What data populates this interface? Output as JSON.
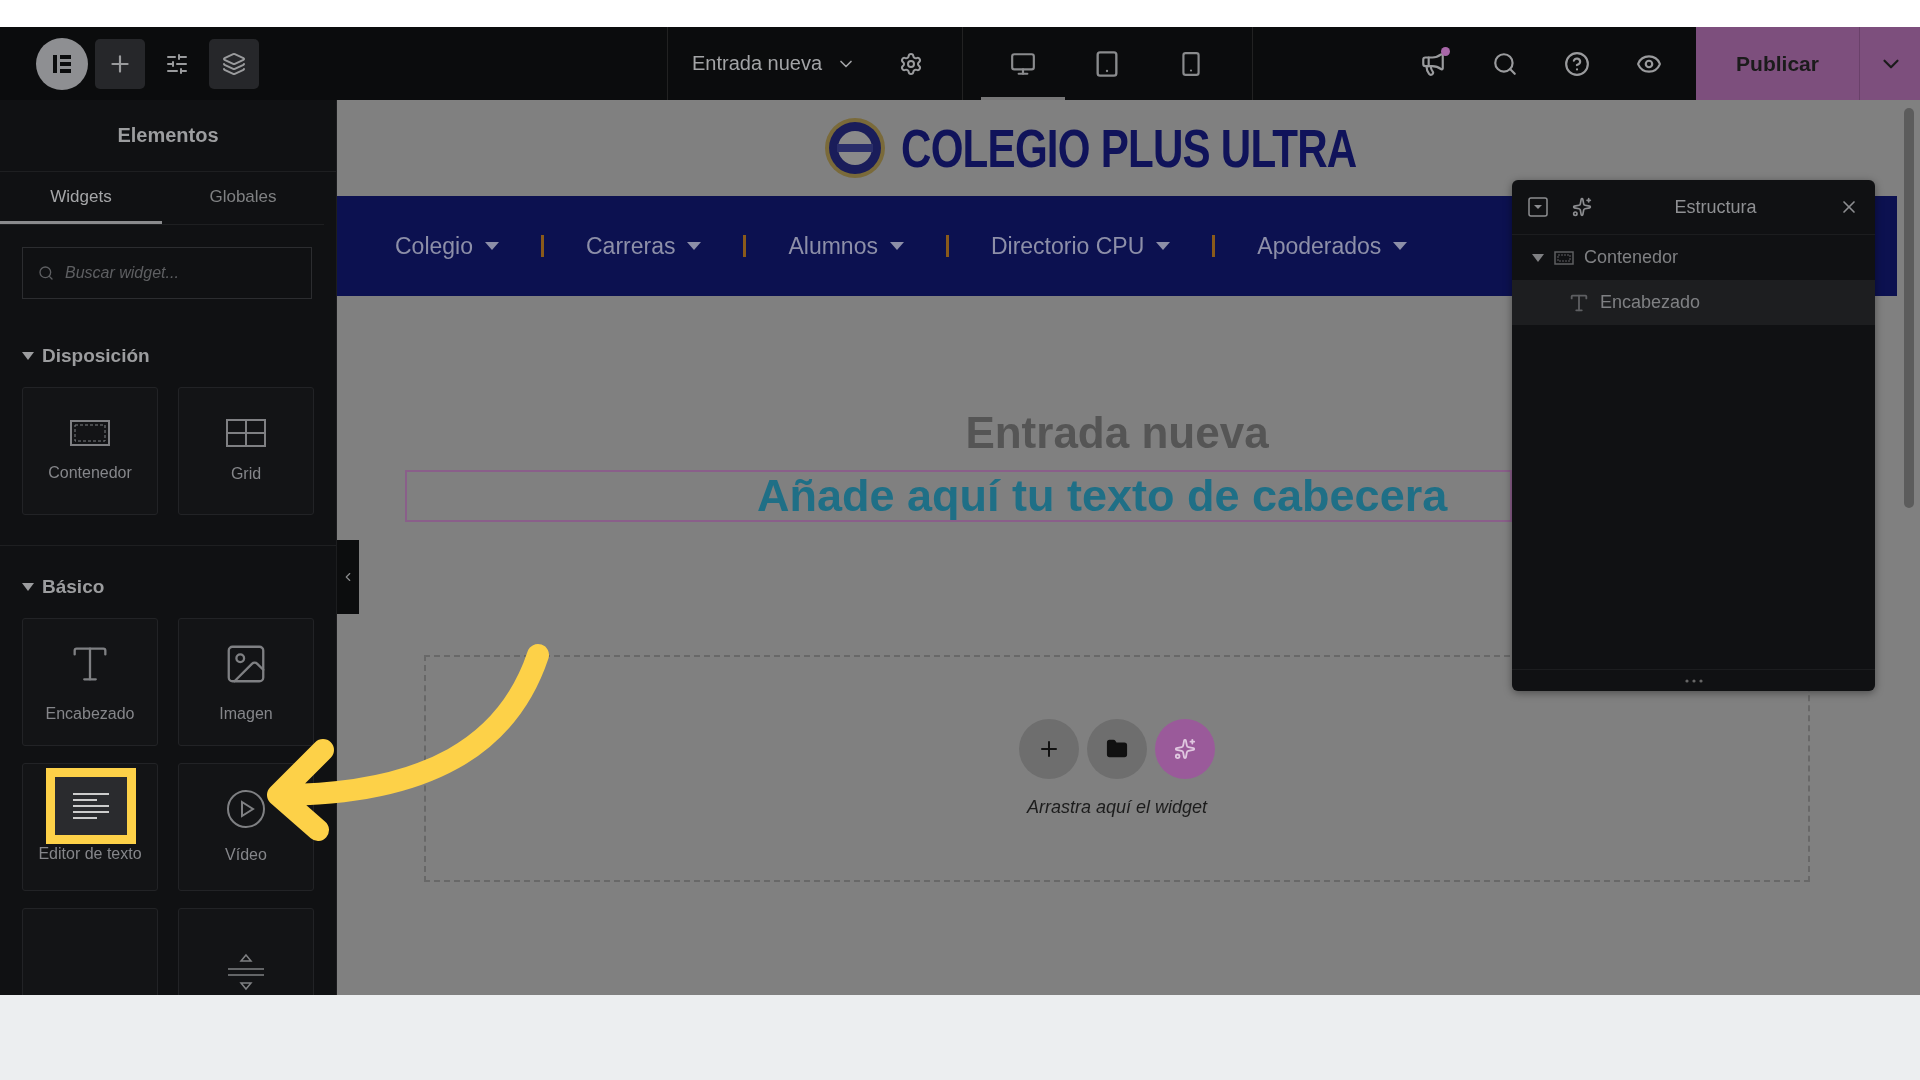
{
  "topbar": {
    "document_title": "Entrada nueva",
    "devices": [
      {
        "kind": "desktop",
        "selected": true
      },
      {
        "kind": "tablet",
        "selected": false
      },
      {
        "kind": "mobile",
        "selected": false
      }
    ],
    "publish_button": "Publicar"
  },
  "panel": {
    "title": "Elementos",
    "tabs": [
      {
        "label": "Widgets",
        "selected": true
      },
      {
        "label": "Globales",
        "selected": false
      }
    ],
    "search": {
      "placeholder": "Buscar widget..."
    },
    "sections": [
      {
        "title": "Disposición",
        "expanded": true,
        "widgets": [
          {
            "kind": "container",
            "label": "Contenedor"
          },
          {
            "kind": "grid",
            "label": "Grid"
          }
        ]
      },
      {
        "title": "Básico",
        "expanded": true,
        "widgets": [
          {
            "kind": "heading",
            "label": "Encabezado"
          },
          {
            "kind": "image",
            "label": "Imagen"
          },
          {
            "kind": "text-editor",
            "label": "Editor de texto",
            "highlighted": true
          },
          {
            "kind": "video",
            "label": "Vídeo"
          },
          {
            "kind": "blank"
          },
          {
            "kind": "divider"
          }
        ]
      }
    ]
  },
  "site": {
    "logo_text": "COLEGIO PLUS ULTRA",
    "nav": [
      "Colegio",
      "Carreras",
      "Alumnos",
      "Directorio CPU",
      "Apoderados"
    ]
  },
  "page": {
    "title": "Entrada nueva",
    "heading": "Añade aquí tu texto de cabecera",
    "drop_hint": "Arrastra aquí el widget"
  },
  "structure": {
    "title": "Estructura",
    "tree": [
      {
        "label": "Contenedor",
        "kind": "container",
        "expanded": true,
        "selected": false,
        "children": [
          {
            "label": "Encabezado",
            "kind": "heading",
            "selected": true
          }
        ]
      }
    ]
  }
}
